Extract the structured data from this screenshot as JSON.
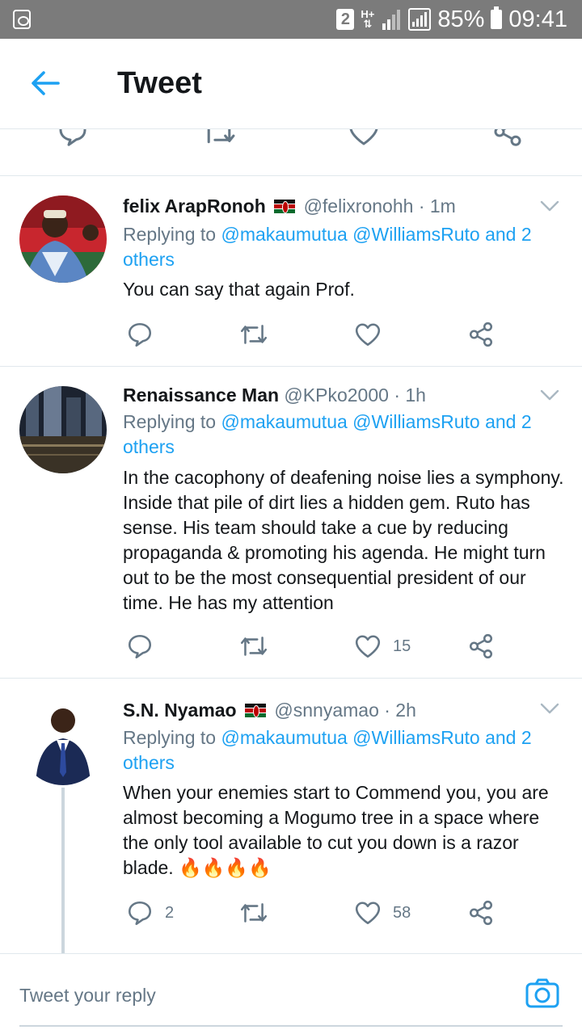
{
  "status_bar": {
    "sim_slot": "2",
    "network": "H+",
    "battery": "85%",
    "time": "09:41"
  },
  "header": {
    "title": "Tweet"
  },
  "tweets": [
    {
      "name": "felix ArapRonoh",
      "handle": "@felixronohh",
      "time": "· 1m",
      "reply_prefix": "Replying to",
      "reply_mentions": "@makaumutua @WilliamsRuto and 2 others",
      "text": "You can say that again Prof.",
      "reply_count": "",
      "like_count": ""
    },
    {
      "name": "Renaissance Man",
      "handle": "@KPko2000",
      "time": "· 1h",
      "reply_prefix": "Replying to",
      "reply_mentions": "@makaumutua @WilliamsRuto and 2 others",
      "text": "In the cacophony of deafening noise lies a symphony. Inside that pile of dirt lies a hidden gem. Ruto has sense. His team should take a cue by  reducing propaganda & promoting his agenda. He might turn out to be the most consequential president of our time. He has my attention",
      "reply_count": "",
      "like_count": "15"
    },
    {
      "name": "S.N. Nyamao",
      "handle": "@snnyamao",
      "time": "· 2h",
      "reply_prefix": "Replying to",
      "reply_mentions": "@makaumutua @WilliamsRuto and 2 others",
      "text": "When your enemies start to Commend you, you are almost becoming a Mogumo tree in a space where the only tool available to cut you down is a razor blade. 🔥🔥🔥🔥",
      "reply_count": "2",
      "like_count": "58"
    }
  ],
  "compose": {
    "placeholder": "Tweet your reply"
  },
  "colors": {
    "accent": "#1da1f2",
    "secondary_text": "#657786",
    "divider": "#e1e8ed"
  }
}
